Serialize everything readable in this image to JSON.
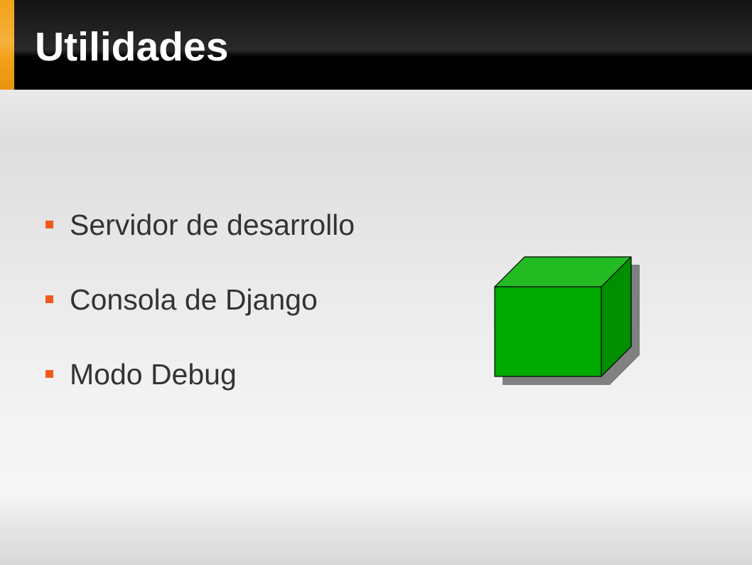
{
  "slide": {
    "title": "Utilidades",
    "bullets": [
      "Servidor de desarrollo",
      "Consola de Django",
      "Modo Debug"
    ]
  },
  "colors": {
    "accent": "#f2a21b",
    "bullet_marker": "#f25a1d",
    "title_bar": "#000000",
    "title_text": "#ffffff",
    "body_text": "#333333",
    "cube_front": "#00aa00",
    "cube_top": "#22bb22",
    "cube_side": "#008f00",
    "cube_shadow": "#808080"
  },
  "icons": {
    "cube": "cube-icon",
    "bullet": "square-bullet-icon"
  }
}
